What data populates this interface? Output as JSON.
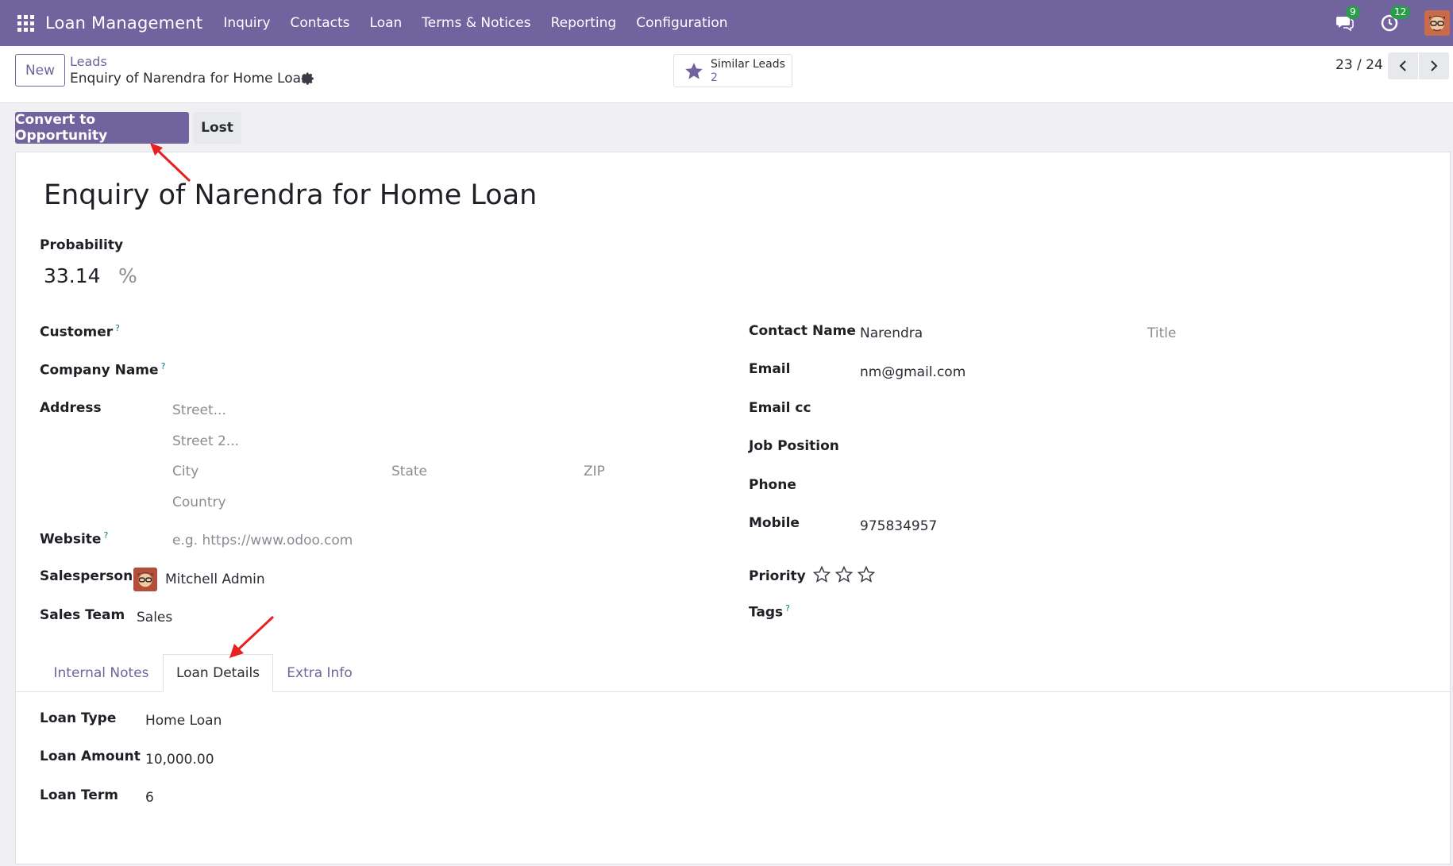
{
  "navbar": {
    "app_title": "Loan Management",
    "menu": [
      "Inquiry",
      "Contacts",
      "Loan",
      "Terms & Notices",
      "Reporting",
      "Configuration"
    ],
    "messages_badge": "9",
    "activities_badge": "12",
    "bg_color": "#71639e"
  },
  "control_panel": {
    "new_label": "New",
    "breadcrumb": "Leads",
    "record_name": "Enquiry of Narendra for Home Loan",
    "similar_label": "Similar Leads",
    "similar_count": "2",
    "pager": "23 / 24"
  },
  "status_bar": {
    "convert_label": "Convert to Opportunity",
    "lost_label": "Lost"
  },
  "form": {
    "title": "Enquiry of Narendra for Home Loan",
    "probability_label": "Probability",
    "probability_value": "33.14",
    "probability_unit": "%",
    "left": {
      "customer_label": "Customer",
      "company_label": "Company Name",
      "address_label": "Address",
      "street_placeholder": "Street...",
      "street2_placeholder": "Street 2...",
      "city_placeholder": "City",
      "state_placeholder": "State",
      "zip_placeholder": "ZIP",
      "country_placeholder": "Country",
      "website_label": "Website",
      "website_placeholder": "e.g. https://www.odoo.com",
      "salesperson_label": "Salesperson",
      "salesperson_value": "Mitchell Admin",
      "sales_team_label": "Sales Team",
      "sales_team_value": "Sales"
    },
    "right": {
      "contact_name_label": "Contact Name",
      "contact_name_value": "Narendra",
      "title_placeholder": "Title",
      "email_label": "Email",
      "email_value": "nm@gmail.com",
      "email_cc_label": "Email cc",
      "job_position_label": "Job Position",
      "phone_label": "Phone",
      "mobile_label": "Mobile",
      "mobile_value": "975834957",
      "priority_label": "Priority",
      "priority_stars": 0,
      "priority_max": 3,
      "tags_label": "Tags"
    },
    "help_mark": "?"
  },
  "tabs": [
    {
      "label": "Internal Notes",
      "active": false
    },
    {
      "label": "Loan Details",
      "active": true
    },
    {
      "label": "Extra Info",
      "active": false
    }
  ],
  "loan_details": {
    "type_label": "Loan Type",
    "type_value": "Home Loan",
    "amount_label": "Loan Amount",
    "amount_value": "10,000.00",
    "term_label": "Loan Term",
    "term_value": "6"
  }
}
